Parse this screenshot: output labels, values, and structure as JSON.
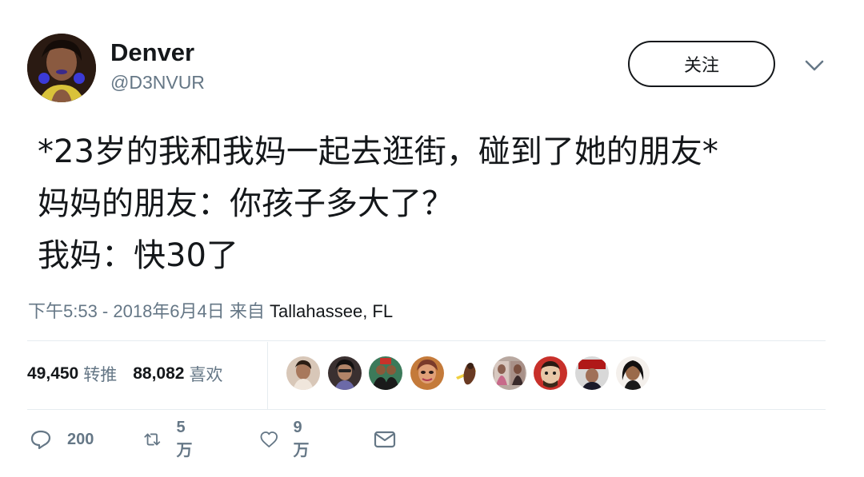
{
  "author": {
    "name": "Denver",
    "handle": "@D3NVUR"
  },
  "follow_label": "关注",
  "tweet_lines": [
    "*23岁的我和我妈一起去逛街，碰到了她的朋友*",
    "妈妈的朋友：你孩子多大了？",
    "我妈：快30了"
  ],
  "timestamp": {
    "time": "下午5:53 - 2018年6月4日 来自 ",
    "location": "Tallahassee, FL"
  },
  "stats": {
    "retweets_count": "49,450",
    "retweets_label": "转推",
    "likes_count": "88,082",
    "likes_label": "喜欢"
  },
  "actions": {
    "reply_count": "200",
    "retweet_count": "5万",
    "like_count": "9万"
  },
  "colors": {
    "text": "#14171a",
    "secondary": "#657786",
    "divider": "#e6ecf0"
  }
}
